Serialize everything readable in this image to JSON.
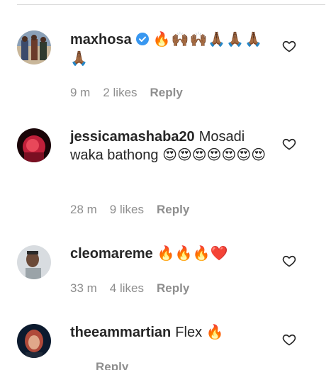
{
  "comments": [
    {
      "username": "maxhosa",
      "verified": true,
      "text": "🔥🙌🏾🙌🏾🙏🏾🙏🏾🙏🏾🙏🏾",
      "time": "9 m",
      "likes": "2 likes",
      "reply": "Reply"
    },
    {
      "username": "jessicamashaba20",
      "verified": false,
      "text": "Mosadi waka bathong 😍😍😍😍😍😍😍",
      "time": "28 m",
      "likes": "9 likes",
      "reply": "Reply"
    },
    {
      "username": "cleomareme",
      "verified": false,
      "text": "🔥🔥🔥❤️",
      "time": "33 m",
      "likes": "4 likes",
      "reply": "Reply"
    },
    {
      "username": "theeammartian",
      "verified": false,
      "text": "Flex 🔥",
      "time": "",
      "likes": "",
      "reply": "Reply"
    }
  ],
  "icons": {
    "like": "heart-outline-icon",
    "verified": "verified-badge-icon"
  },
  "colors": {
    "verified": "#3897f0",
    "meta": "#8e8e8e",
    "text": "#262626"
  }
}
